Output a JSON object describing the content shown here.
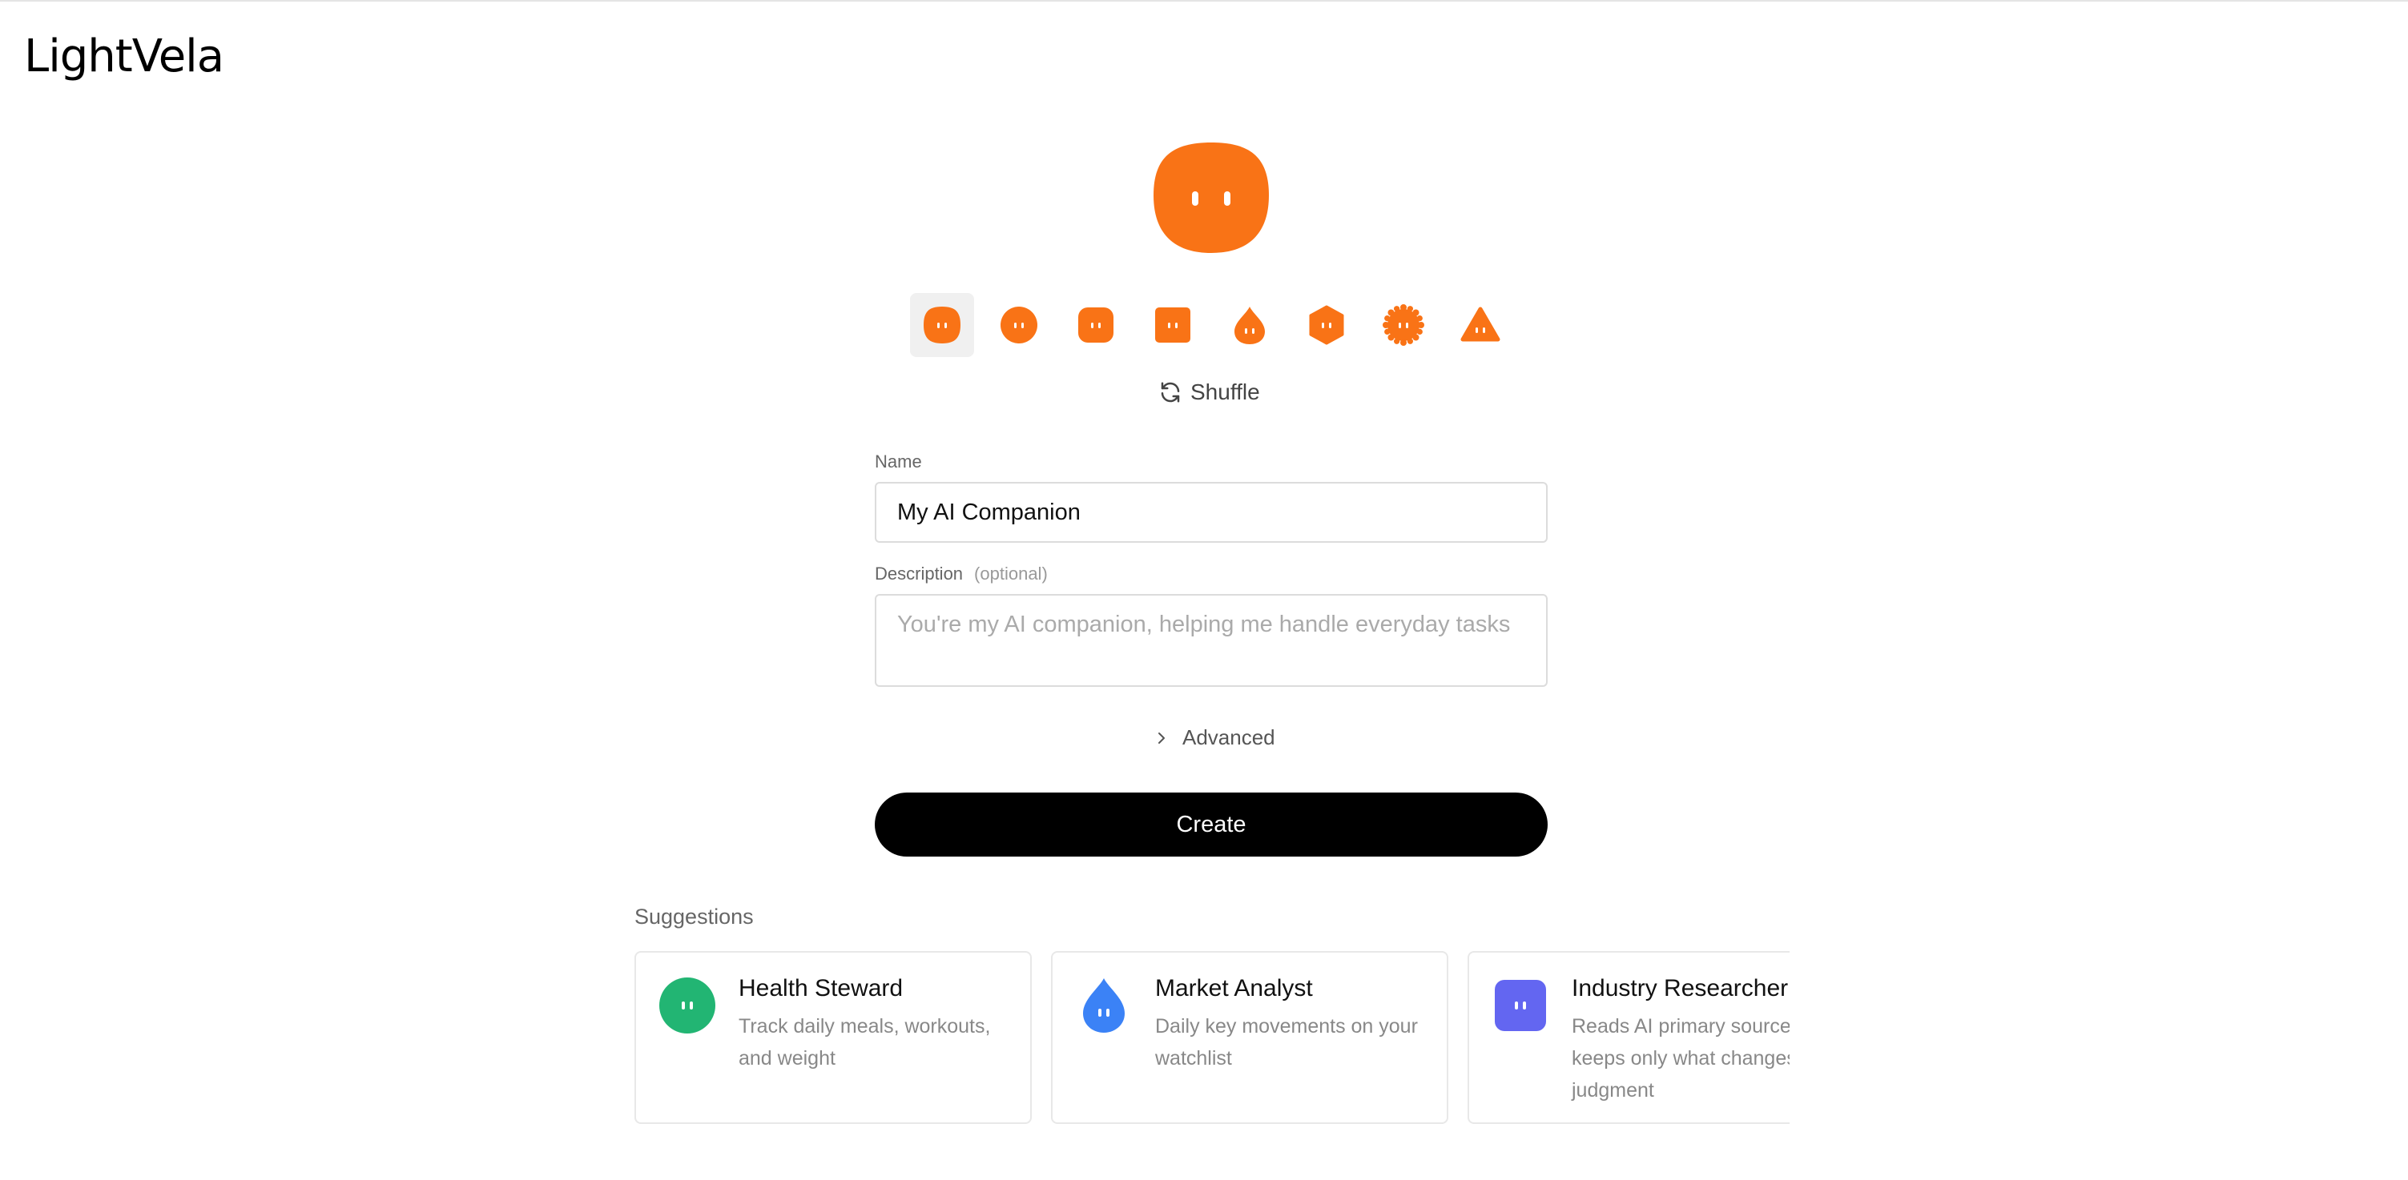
{
  "app": {
    "logo": "LightVela"
  },
  "avatar": {
    "color": "#F97316",
    "icon": "rounded-blob-face-icon"
  },
  "shapes": [
    {
      "name": "blob-shape-icon",
      "selected": true
    },
    {
      "name": "circle-shape-icon",
      "selected": false
    },
    {
      "name": "rounded-square-shape-icon",
      "selected": false
    },
    {
      "name": "square-shape-icon",
      "selected": false
    },
    {
      "name": "droplet-shape-icon",
      "selected": false
    },
    {
      "name": "hexagon-shape-icon",
      "selected": false
    },
    {
      "name": "gear-shape-icon",
      "selected": false
    },
    {
      "name": "triangle-shape-icon",
      "selected": false
    }
  ],
  "shuffle": {
    "label": "Shuffle",
    "icon": "refresh-icon"
  },
  "form": {
    "name_label": "Name",
    "name_value": "My AI Companion",
    "description_label": "Description",
    "description_optional": "(optional)",
    "description_placeholder": "You're my AI companion, helping me handle everyday tasks",
    "advanced_label": "Advanced",
    "create_label": "Create"
  },
  "suggestions": {
    "title": "Suggestions",
    "cards": [
      {
        "title": "Health Steward",
        "desc": "Track daily meals, workouts, and weight",
        "color": "#22B573",
        "icon": "circle-face-icon"
      },
      {
        "title": "Market Analyst",
        "desc": "Daily key movements on your watchlist",
        "color": "#3B82F6",
        "icon": "droplet-face-icon"
      },
      {
        "title": "Industry Researcher",
        "desc": "Reads AI primary sources daily, keeps only what changes your judgment",
        "color": "#6366F1",
        "icon": "rounded-square-face-icon"
      }
    ]
  },
  "colors": {
    "accent": "#F97316",
    "primary_button": "#000000"
  }
}
